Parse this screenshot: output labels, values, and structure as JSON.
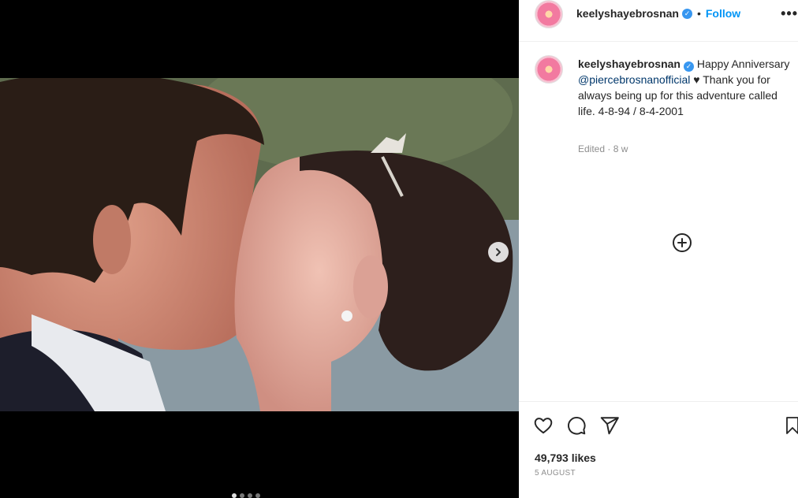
{
  "post": {
    "username": "keelyshayebrosnan",
    "verified": true,
    "follow_label": "Follow",
    "more_label": "•••",
    "caption_prefix": "Happy Anniversary ",
    "caption_mention": "@piercebrosnanofficial",
    "caption_suffix": " ♥ Thank you for always being up for this adventure called life. 4-8-94 / 8-4-2001",
    "edited_label": "Edited",
    "age": "8 w",
    "likes": "49,793 likes",
    "date": "5 AUGUST"
  },
  "media": {
    "image_count": 4,
    "active_index": 0
  },
  "icons": {
    "like": "heart-icon",
    "comment": "comment-icon",
    "share": "share-icon",
    "save": "bookmark-icon",
    "next": "chevron-right-icon",
    "load_more": "plus-circle-icon",
    "verified": "verified-badge-icon"
  },
  "colors": {
    "link": "#0095f6",
    "mention": "#00376b",
    "verified": "#3897f0"
  }
}
